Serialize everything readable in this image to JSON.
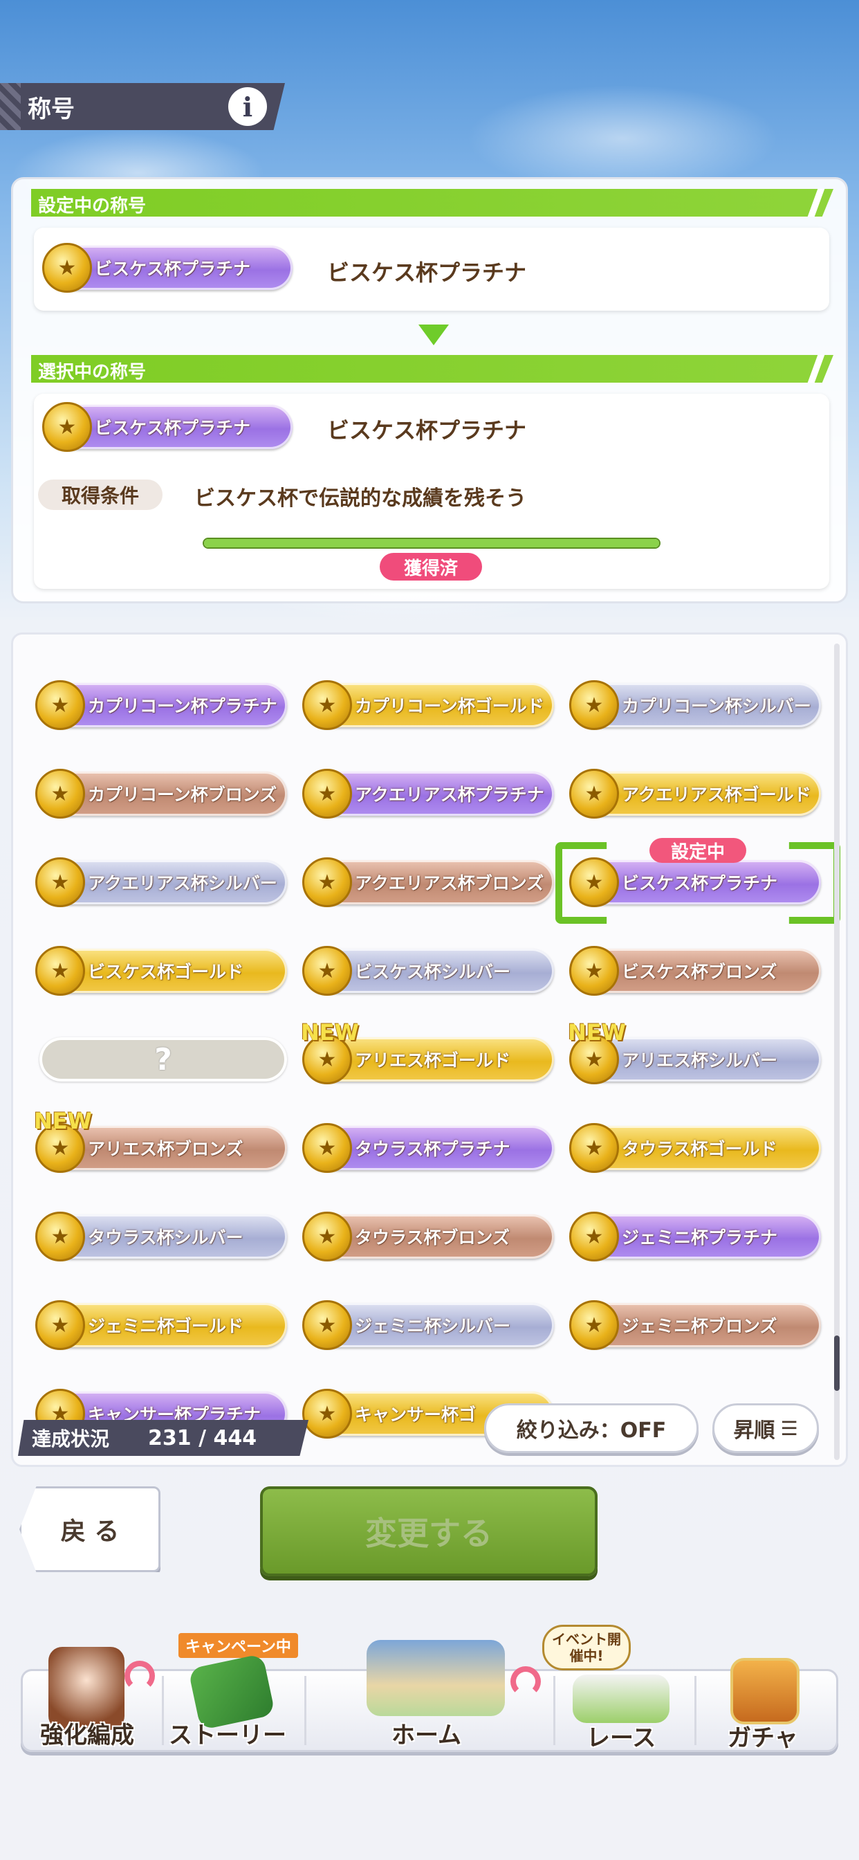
{
  "header": {
    "title": "称号",
    "info_label": "i"
  },
  "current_section": {
    "label": "設定中の称号",
    "badge_text": "ビスケス杯プラチナ",
    "name": "ビスケス杯プラチナ"
  },
  "selected_section": {
    "label": "選択中の称号",
    "badge_text": "ビスケス杯プラチナ",
    "name": "ビスケス杯プラチナ",
    "condition_label": "取得条件",
    "condition_text": "ビスケス杯で伝説的な成績を残そう",
    "progress": 1.0,
    "status": "獲得済"
  },
  "grid": {
    "current_tag": "設定中",
    "new_tag": "NEW",
    "items": [
      {
        "text": "カプリコーン杯プラチナ",
        "tier": "platinum"
      },
      {
        "text": "カプリコーン杯ゴールド",
        "tier": "gold"
      },
      {
        "text": "カプリコーン杯シルバー",
        "tier": "silver"
      },
      {
        "text": "カプリコーン杯ブロンズ",
        "tier": "bronze"
      },
      {
        "text": "アクエリアス杯プラチナ",
        "tier": "platinum"
      },
      {
        "text": "アクエリアス杯ゴールド",
        "tier": "gold"
      },
      {
        "text": "アクエリアス杯シルバー",
        "tier": "silver"
      },
      {
        "text": "アクエリアス杯ブロンズ",
        "tier": "bronze"
      },
      {
        "text": "ビスケス杯プラチナ",
        "tier": "platinum",
        "current": true
      },
      {
        "text": "ビスケス杯ゴールド",
        "tier": "gold"
      },
      {
        "text": "ビスケス杯シルバー",
        "tier": "silver"
      },
      {
        "text": "ビスケス杯ブロンズ",
        "tier": "bronze"
      },
      {
        "text": "?",
        "tier": "unknown"
      },
      {
        "text": "アリエス杯ゴールド",
        "tier": "gold",
        "new": true
      },
      {
        "text": "アリエス杯シルバー",
        "tier": "silver",
        "new": true
      },
      {
        "text": "アリエス杯ブロンズ",
        "tier": "bronze",
        "new": true
      },
      {
        "text": "タウラス杯プラチナ",
        "tier": "platinum"
      },
      {
        "text": "タウラス杯ゴールド",
        "tier": "gold"
      },
      {
        "text": "タウラス杯シルバー",
        "tier": "silver"
      },
      {
        "text": "タウラス杯ブロンズ",
        "tier": "bronze"
      },
      {
        "text": "ジェミニ杯プラチナ",
        "tier": "platinum"
      },
      {
        "text": "ジェミニ杯ゴールド",
        "tier": "gold"
      },
      {
        "text": "ジェミニ杯シルバー",
        "tier": "silver"
      },
      {
        "text": "ジェミニ杯ブロンズ",
        "tier": "bronze"
      },
      {
        "text": "キャンサー杯プラチナ",
        "tier": "platinum"
      },
      {
        "text": "キャンサー杯ゴ",
        "tier": "gold"
      }
    ]
  },
  "status": {
    "label": "達成状況",
    "value": "231 / 444"
  },
  "filter": {
    "label": "絞り込み：OFF"
  },
  "sort": {
    "label": "昇順"
  },
  "actions": {
    "back_label": "戻 る",
    "change_label": "変更する"
  },
  "nav": {
    "items": [
      {
        "label": "強化編成"
      },
      {
        "label": "ストーリー",
        "ribbon": "キャンペーン中"
      },
      {
        "label": "ホーム"
      },
      {
        "label": "レース",
        "bubble": "イベント開催中!"
      },
      {
        "label": "ガチャ"
      }
    ]
  },
  "colors": {
    "accent_green": "#7fcd25",
    "pink": "#f04c7b",
    "dark_bar": "#4a4a5e"
  }
}
